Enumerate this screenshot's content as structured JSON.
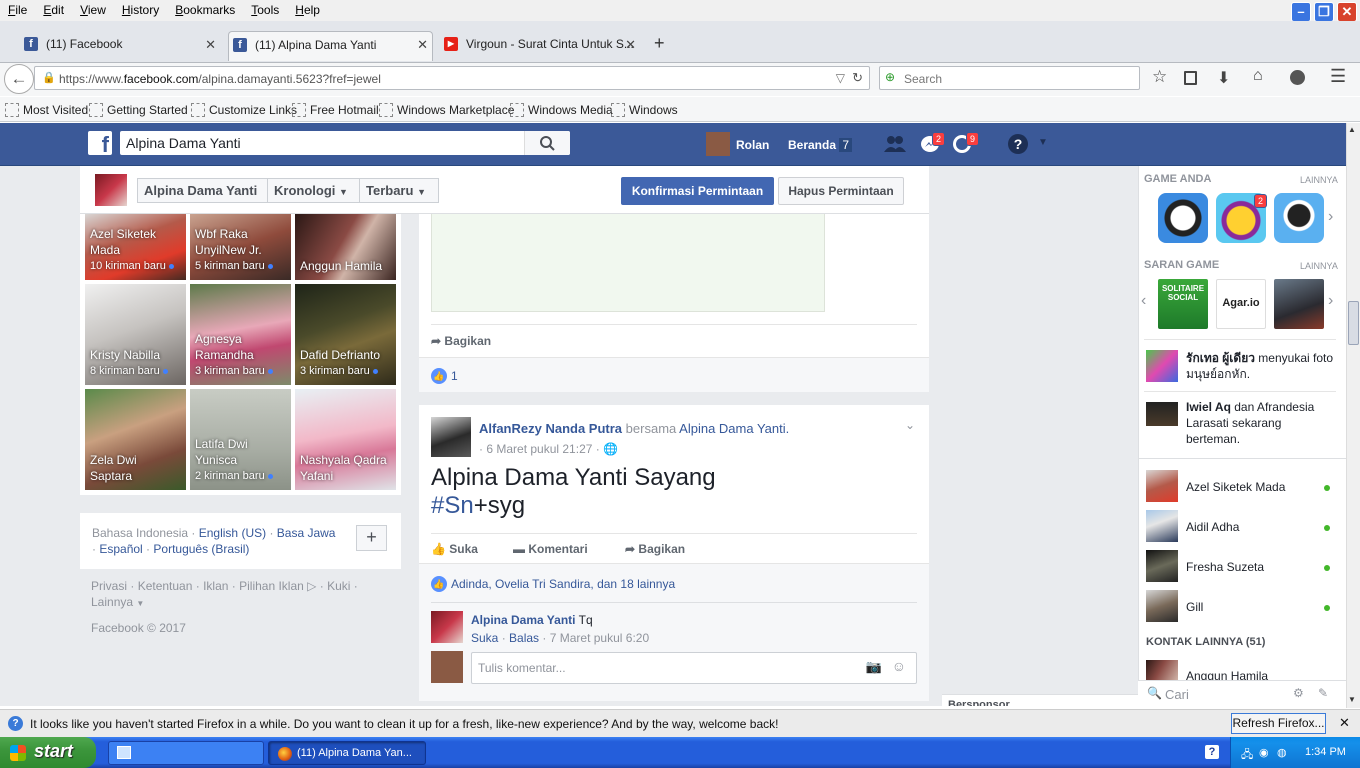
{
  "menu": [
    "File",
    "Edit",
    "View",
    "History",
    "Bookmarks",
    "Tools",
    "Help"
  ],
  "tabs": [
    {
      "title": "(11) Facebook"
    },
    {
      "title": "(11) Alpina Dama Yanti"
    },
    {
      "title": "Virgoun - Surat Cinta Untuk S..."
    }
  ],
  "url": {
    "prefix": "https://www.",
    "domain": "facebook.com",
    "path": "/alpina.damayanti.5623?fref=jewel"
  },
  "browser_search_placeholder": "Search",
  "bookmarks": [
    "Most Visited",
    "Getting Started",
    "Customize Links",
    "Free Hotmail",
    "Windows Marketplace",
    "Windows Media",
    "Windows"
  ],
  "fb": {
    "search_value": "Alpina Dama Yanti",
    "user": "Rolan",
    "home": "Beranda",
    "home_count": "7",
    "msg_badge": "2",
    "notif_badge": "9"
  },
  "profile": {
    "name": "Alpina Dama Yanti",
    "nav1": "Kronologi",
    "nav2": "Terbaru",
    "confirm": "Konfirmasi Permintaan",
    "delete": "Hapus Permintaan"
  },
  "friends": [
    {
      "name": "Azel Siketek Mada",
      "new": "10 kiriman baru"
    },
    {
      "name": "Wbf Raka UnyilNew Jr.",
      "new": "5 kiriman baru"
    },
    {
      "name": "Anggun Hamila",
      "new": ""
    },
    {
      "name": "Kristy Nabilla",
      "new": "8 kiriman baru"
    },
    {
      "name": "Agnesya Ramandha",
      "new": "3 kiriman baru"
    },
    {
      "name": "Dafid Defrianto",
      "new": "3 kiriman baru"
    },
    {
      "name": "Zela Dwi Saptara",
      "new": ""
    },
    {
      "name": "Latifa Dwi Yunisca",
      "new": "2 kiriman baru"
    },
    {
      "name": "Nashyala Qadra Yafani",
      "new": ""
    }
  ],
  "languages": {
    "current": "Bahasa Indonesia",
    "l1": "English (US)",
    "l2": "Basa Jawa",
    "l3": "Español",
    "l4": "Português (Brasil)"
  },
  "footer": {
    "links": [
      "Privasi",
      "Ketentuan",
      "Iklan",
      "Pilihan Iklan",
      "Kuki",
      "Lainnya"
    ],
    "copyright": "Facebook © 2017"
  },
  "post1": {
    "share": "Bagikan",
    "likes": "1"
  },
  "post2": {
    "author": "AlfanRezy Nanda Putra",
    "with": "bersama",
    "tagged": "Alpina Dama Yanti.",
    "time": "6 Maret pukul 21:27",
    "text1": "Alpina Dama Yanti Sayang",
    "hashtag": "#Sn",
    "text2": "+syg",
    "like": "Suka",
    "comment": "Komentari",
    "share": "Bagikan",
    "likers": "Adinda, Ovelia Tri Sandira, dan 18 lainnya",
    "c_author": "Alpina Dama Yanti",
    "c_text": "Tq",
    "c_like": "Suka",
    "c_reply": "Balas",
    "c_time": "7 Maret pukul 6:20",
    "c_placeholder": "Tulis komentar..."
  },
  "right": {
    "games": "GAME ANDA",
    "more": "LAINNYA",
    "game_badge": "2",
    "suggest": "SARAN GAME",
    "g_solitaire": "SOLITAIRE SOCIAL",
    "g_agar": "Agar.io",
    "t1_name": "รักเทอ ผู้เดียว",
    "t1_text": " menyukai foto มนุษย์อกหัก.",
    "t2_name": "Iwiel Aq",
    "t2_text": " dan Afrandesia Larasati sekarang berteman.",
    "contacts": [
      "Azel Siketek Mada",
      "Aidil Adha",
      "Fresha Suzeta",
      "Gill"
    ],
    "more_contacts": "KONTAK LAINNYA (51)",
    "partial_contact": "Anggun Hamila",
    "chat_search": "Cari",
    "sponsor": "Bersponsor"
  },
  "notification": {
    "text": "It looks like you haven't started Firefox in a while. Do you want to clean it up for a fresh, like-new experience? And by the way, welcome back!",
    "button": "Refresh Firefox..."
  },
  "taskbar": {
    "start": "start",
    "window": "(11) Alpina Dama Yan...",
    "time": "1:34 PM"
  },
  "colors": {
    "fb_blue": "#3b5998",
    "link": "#365899",
    "online": "#42b72a",
    "badge": "#fa3e3e"
  }
}
